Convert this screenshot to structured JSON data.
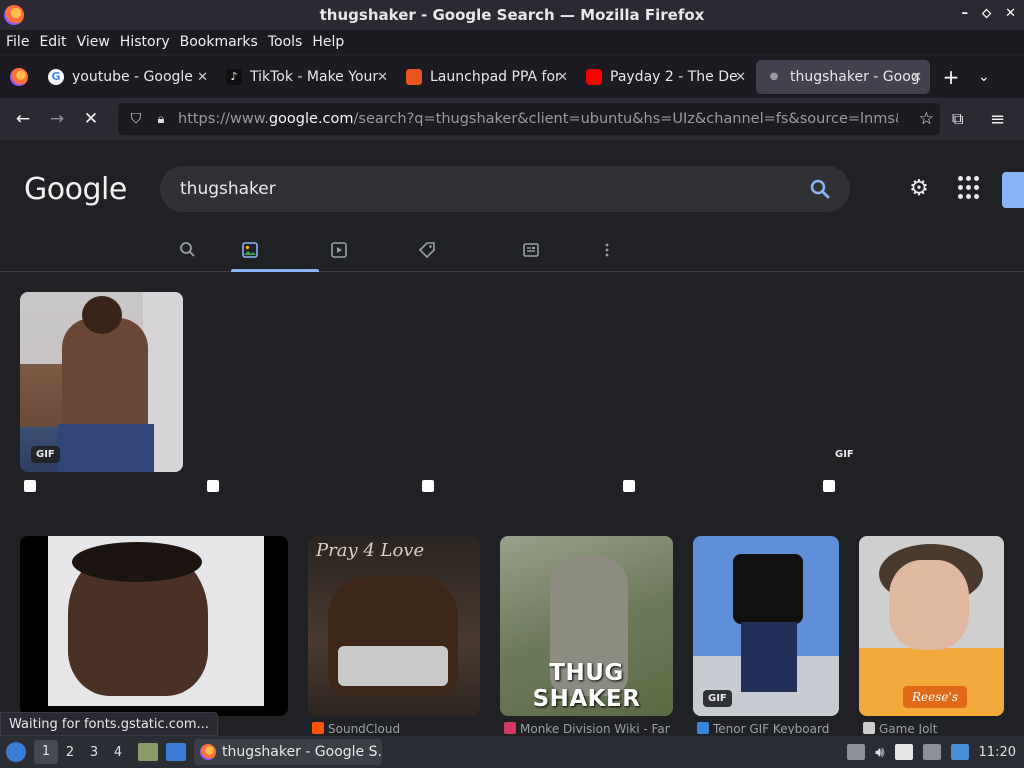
{
  "window": {
    "title": "thugshaker - Google Search — Mozilla Firefox",
    "controls": [
      "–",
      "⬦",
      "✕"
    ]
  },
  "menubar": [
    "File",
    "Edit",
    "View",
    "History",
    "Bookmarks",
    "Tools",
    "Help"
  ],
  "tabs": [
    {
      "label": "youtube - Google",
      "icon_color": "#4285f4",
      "icon": "google-icon"
    },
    {
      "label": "TikTok - Make Your",
      "icon_color": "#111111",
      "icon": "tiktok-icon"
    },
    {
      "label": "Launchpad PPA for",
      "icon_color": "#e95420",
      "icon": "launchpad-icon"
    },
    {
      "label": "Payday 2 - The De",
      "icon_color": "#ff0000",
      "icon": "youtube-icon"
    },
    {
      "label": "thugshaker - Goog",
      "icon_color": "#9a9aa2",
      "icon": "loading-dot-icon",
      "active": true
    }
  ],
  "navbar": {
    "url_prefix": "https://www.",
    "url_domain": "google.com",
    "url_rest": "/search?q=thugshaker&client=ubuntu&hs=UIz&channel=fs&source=lnms&tbm"
  },
  "google": {
    "logo": "Google",
    "query": "thugshaker"
  },
  "results": {
    "row1_gif_label": "GIF",
    "row1_gif2_label": "GIF",
    "row2_gif_label": "GIF",
    "row2_captions": [
      "THUG SHAKER",
      "Pray 4 Love"
    ],
    "sources": [
      {
        "label": "SoundCloud",
        "color": "#ff5500"
      },
      {
        "label": "Monke Division Wiki - Fan",
        "color": "#d63864"
      },
      {
        "label": "Tenor GIF Keyboard",
        "color": "#3a85d8"
      },
      {
        "label": "Game Jolt",
        "color": "#cccccc"
      }
    ],
    "shirt_logo": "Reese's"
  },
  "status": "Waiting for fonts.gstatic.com...",
  "taskbar": {
    "workspaces": [
      "1",
      "2",
      "3",
      "4"
    ],
    "active_task": "thugshaker - Google S...",
    "clock": "11:20"
  }
}
